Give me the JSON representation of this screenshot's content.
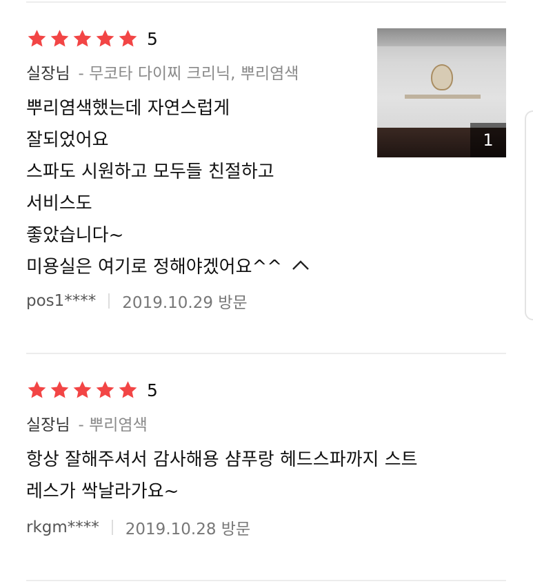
{
  "reviews": [
    {
      "score": "5",
      "designer": "실장님",
      "services": "- 무코타 다이찌 크리닉, 뿌리염색",
      "lines": [
        "뿌리염색했는데 자연스럽게",
        "잘되었어요",
        "스파도 시원하고 모두들 친절하고",
        "서비스도",
        "좋았습니다~",
        "미용실은 여기로 정해야겠어요^^"
      ],
      "user": "pos1****",
      "date": "2019.10.29 방문",
      "photo_count": "1"
    },
    {
      "score": "5",
      "designer": "실장님",
      "services": "- 뿌리염색",
      "lines": [
        "항상 잘해주셔서 감사해용 샴푸랑 헤드스파까지 스트",
        "레스가 싹날라가요~"
      ],
      "user": "rkgm****",
      "date": "2019.10.28 방문"
    }
  ],
  "colors": {
    "star": "#f24545",
    "muted": "#8a8a8a",
    "divider": "#ececec"
  },
  "icons": {
    "star": "star-icon",
    "collapse": "chevron-up-icon"
  }
}
